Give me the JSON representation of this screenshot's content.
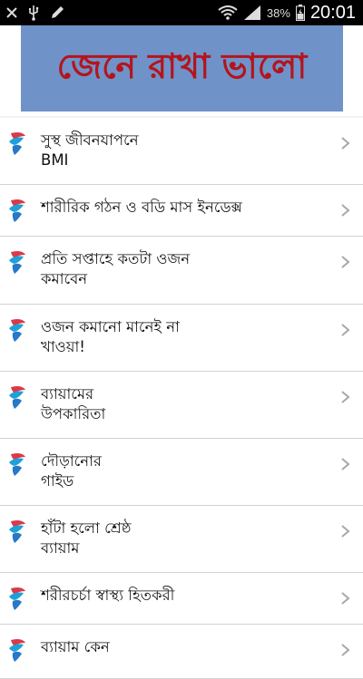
{
  "status_bar": {
    "battery_percent": "38%",
    "time": "20:01",
    "icons": [
      "cross-icon",
      "usb-icon",
      "pen-icon",
      "wifi-icon",
      "signal-icon",
      "battery-icon"
    ]
  },
  "banner": {
    "title": "জেনে রাখা ভালো",
    "background": "#6f93c9",
    "text_color": "#b3151d"
  },
  "list": {
    "items": [
      {
        "lines": [
          "সুস্থ জীবনযাপনে",
          "BMI"
        ]
      },
      {
        "lines": [
          "শারীরিক গঠন ও বডি মাস ইনডেক্স"
        ]
      },
      {
        "lines": [
          "প্রতি সপ্তাহে কতটা ওজন",
          "কমাবেন"
        ]
      },
      {
        "lines": [
          "ওজন কমানো মানেই না",
          "খাওয়া!"
        ]
      },
      {
        "lines": [
          "ব্যায়ামের",
          "উপকারিতা"
        ]
      },
      {
        "lines": [
          "দৌড়ানোর",
          "গাইড"
        ]
      },
      {
        "lines": [
          "হাঁটা হলো শ্রেষ্ঠ",
          "ব্যায়াম"
        ]
      },
      {
        "lines": [
          "শরীরচর্চা স্বাস্থ্য হিতকরী"
        ]
      },
      {
        "lines": [
          "ব্যায়াম কেন"
        ]
      }
    ]
  }
}
